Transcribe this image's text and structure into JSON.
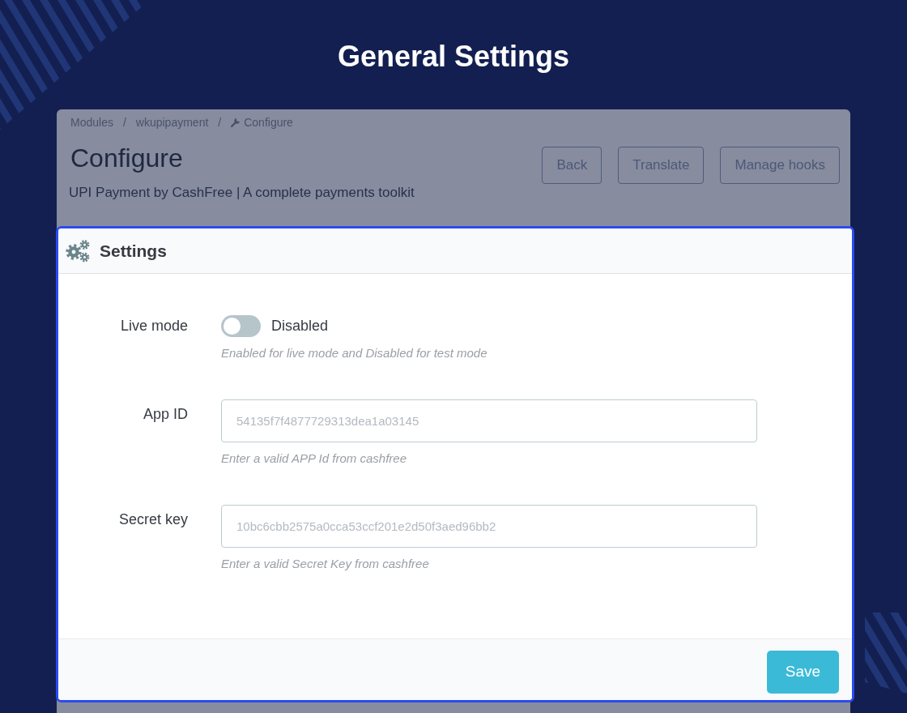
{
  "page": {
    "title": "General Settings"
  },
  "breadcrumb": [
    {
      "kind": "link",
      "label": "Modules"
    },
    {
      "kind": "separator",
      "label": "/"
    },
    {
      "kind": "link",
      "label": "wkupipayment"
    },
    {
      "kind": "separator",
      "label": "/"
    },
    {
      "kind": "current",
      "label": "Configure"
    }
  ],
  "header": {
    "title": "Configure",
    "subtitle": "UPI Payment by CashFree | A complete payments toolkit",
    "buttons": [
      "Back",
      "Translate",
      "Manage hooks"
    ]
  },
  "settings_panel": {
    "title": "Settings",
    "fields": [
      {
        "kind": "switch",
        "label": "Live mode",
        "on": false,
        "state_label": "Disabled",
        "help": "Enabled for live mode and Disabled for test mode"
      },
      {
        "kind": "text",
        "label": "App ID",
        "value": "54135f7f4877729313dea1a03145",
        "help": "Enter a valid APP Id from cashfree"
      },
      {
        "kind": "text",
        "label": "Secret key",
        "value": "10bc6cbb2575a0cca53ccf201e2d50f3aed96bb2",
        "help": "Enter a valid Secret Key from cashfree"
      }
    ],
    "save_button": "Save"
  }
}
